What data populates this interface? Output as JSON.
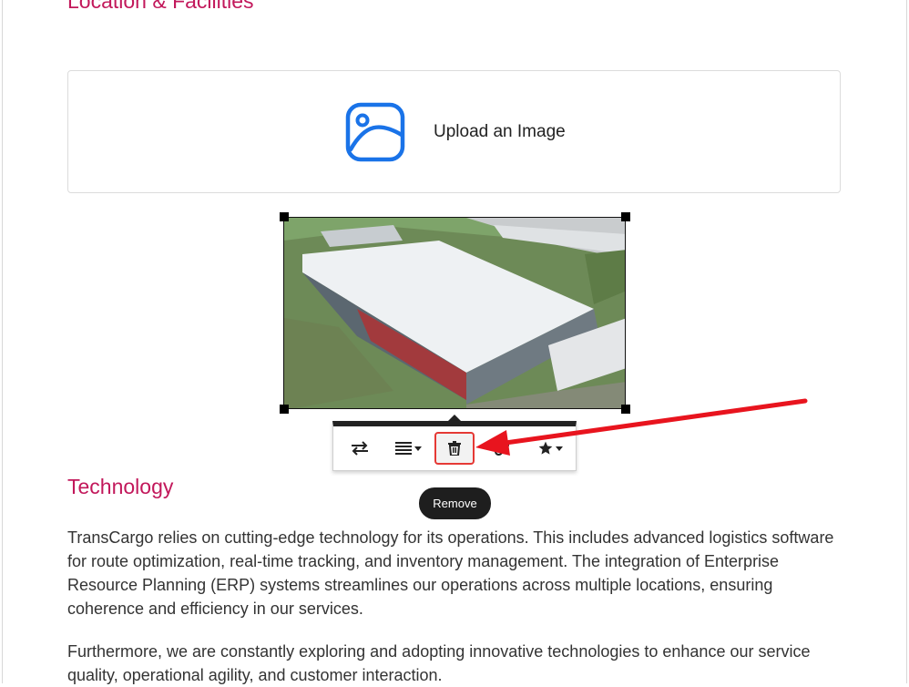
{
  "sections": {
    "location_heading": "Location & Facilities",
    "technology_heading": "Technology"
  },
  "upload": {
    "label": "Upload an Image",
    "icon": "image-icon"
  },
  "image_toolbar": {
    "buttons": [
      {
        "name": "replace",
        "icon": "swap-arrows-icon"
      },
      {
        "name": "align",
        "icon": "align-lines-icon"
      },
      {
        "name": "remove",
        "icon": "trash-icon"
      },
      {
        "name": "link",
        "icon": "link-icon"
      },
      {
        "name": "style",
        "icon": "star-icon"
      }
    ],
    "tooltip": "Remove"
  },
  "content": {
    "paragraph_1": "TransCargo relies on cutting-edge technology for its operations. This includes advanced logistics software for route optimization, real-time tracking, and inventory management. The integration of Enterprise Resource Planning (ERP) systems streamlines our operations across multiple locations, ensuring coherence and efficiency in our services.",
    "paragraph_2": "Furthermore, we are constantly exploring and adopting innovative technologies to enhance our service quality, operational agility, and customer interaction."
  },
  "colors": {
    "heading": "#c2185b",
    "upload_icon": "#1a73e8",
    "highlight": "#e53935",
    "tooltip_bg": "#1e1e1e"
  }
}
